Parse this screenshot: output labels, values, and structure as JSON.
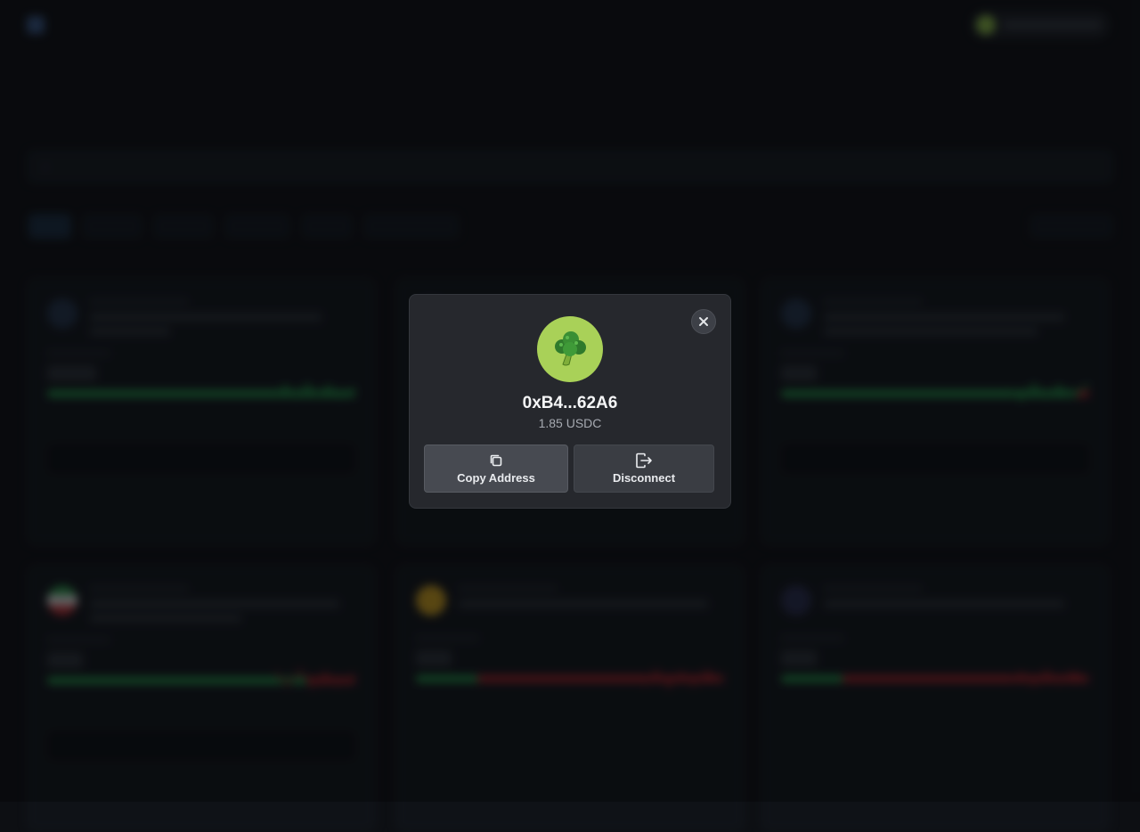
{
  "modal": {
    "address": "0xB4...62A6",
    "balance": "1.85 USDC",
    "copy_label": "Copy Address",
    "disconnect_label": "Disconnect",
    "avatar_glyph": "🥦",
    "avatar_color": "#a9d158"
  },
  "colors": {
    "modal_background": "#26282d",
    "yes_green": "#25a24f",
    "no_red": "#b3262d"
  },
  "icons": {
    "close": "close-icon",
    "copy": "copy-icon",
    "disconnect": "logout-icon"
  }
}
